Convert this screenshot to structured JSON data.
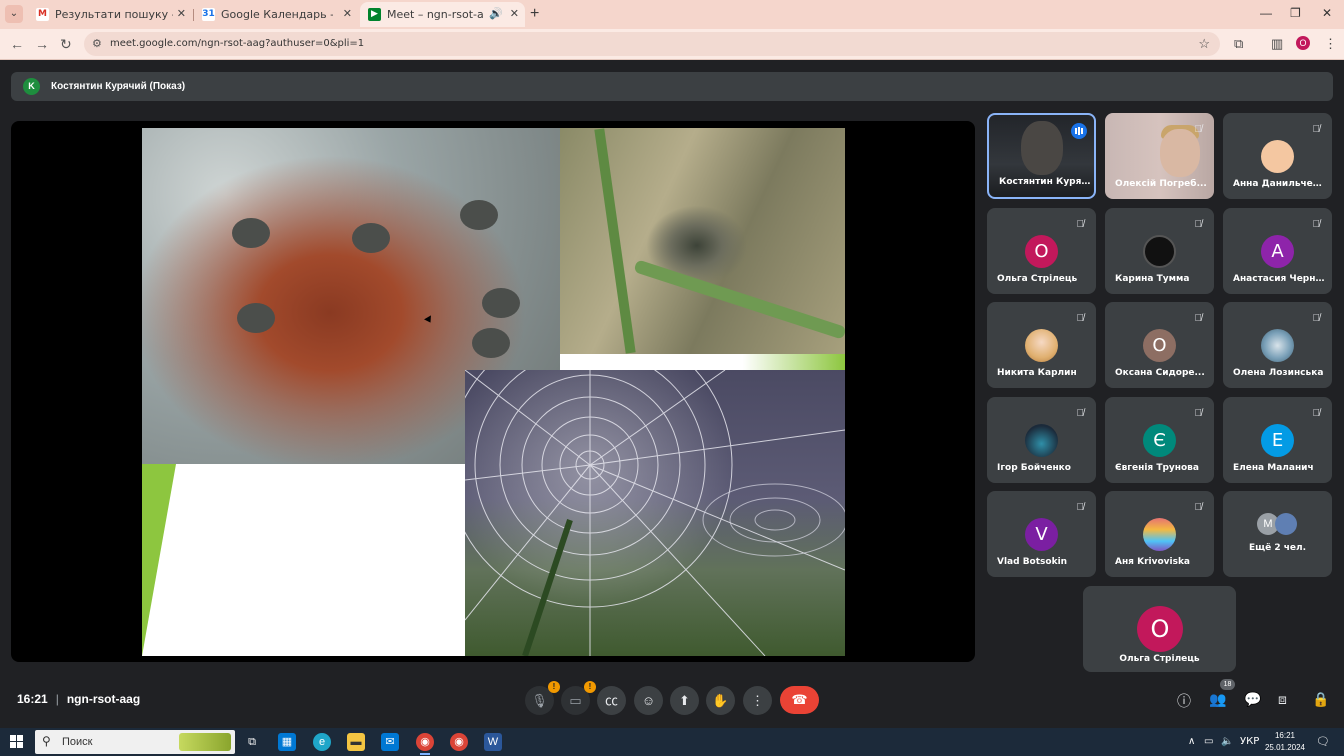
{
  "browser": {
    "tabs": [
      {
        "title": "Результати пошуку - olhastrilet",
        "favicon": "gmail-icon"
      },
      {
        "title": "Google Календарь - сентябрь",
        "favicon": "calendar-icon"
      },
      {
        "title": "Meet – ngn-rsot-aag",
        "favicon": "meet-icon",
        "active": true
      }
    ],
    "url": "meet.google.com/ngn-rsot-aag?authuser=0&pli=1",
    "profile_initial": "O"
  },
  "meet": {
    "presenter_initial": "K",
    "presenter_label": "Костянтин Курячий (Показ)",
    "time": "16:21",
    "meeting_code": "ngn-rsot-aag",
    "participant_count": "18",
    "participants": [
      {
        "name": "Костянтин Куря...",
        "type": "video",
        "speaking": true
      },
      {
        "name": "Олексій Погреб...",
        "type": "video",
        "muted": true
      },
      {
        "name": "Анна Данильчен...",
        "initial": "",
        "color": "#f4c7a1",
        "muted": true
      },
      {
        "name": "Ольга Стрілець",
        "initial": "О",
        "color": "#c2185b",
        "muted": true
      },
      {
        "name": "Карина Тумма",
        "initial": "",
        "color": "#111111",
        "muted": true
      },
      {
        "name": "Анастасия Черн...",
        "initial": "А",
        "color": "#8e24aa",
        "muted": true
      },
      {
        "name": "Никита Карлин",
        "initial": "",
        "color": "#e0b070",
        "muted": true
      },
      {
        "name": "Оксана Сидоре...",
        "initial": "О",
        "color": "#8d6e63",
        "muted": true
      },
      {
        "name": "Олена Лозинська",
        "initial": "",
        "color": "#7aa0b8",
        "muted": true
      },
      {
        "name": "Ігор Бойченко",
        "initial": "",
        "color": "#1b2a3a",
        "muted": true
      },
      {
        "name": "Євгенія Трунова",
        "initial": "Є",
        "color": "#00897b",
        "muted": true
      },
      {
        "name": "Елена Маланич",
        "initial": "Е",
        "color": "#039be5",
        "muted": true
      },
      {
        "name": "Vlad Botsokin",
        "initial": "V",
        "color": "#7b1fa2",
        "muted": true
      },
      {
        "name": "Аня Krivoviska",
        "initial": "",
        "color": "#e57373",
        "muted": true
      }
    ],
    "more_label": "Ещё 2 чел.",
    "more_initial": "M",
    "self_tile": {
      "name": "Ольга Стрілець",
      "initial": "О"
    }
  },
  "taskbar": {
    "search_placeholder": "Поиск",
    "lang": "УКР",
    "time": "16:21",
    "date": "25.01.2024"
  }
}
